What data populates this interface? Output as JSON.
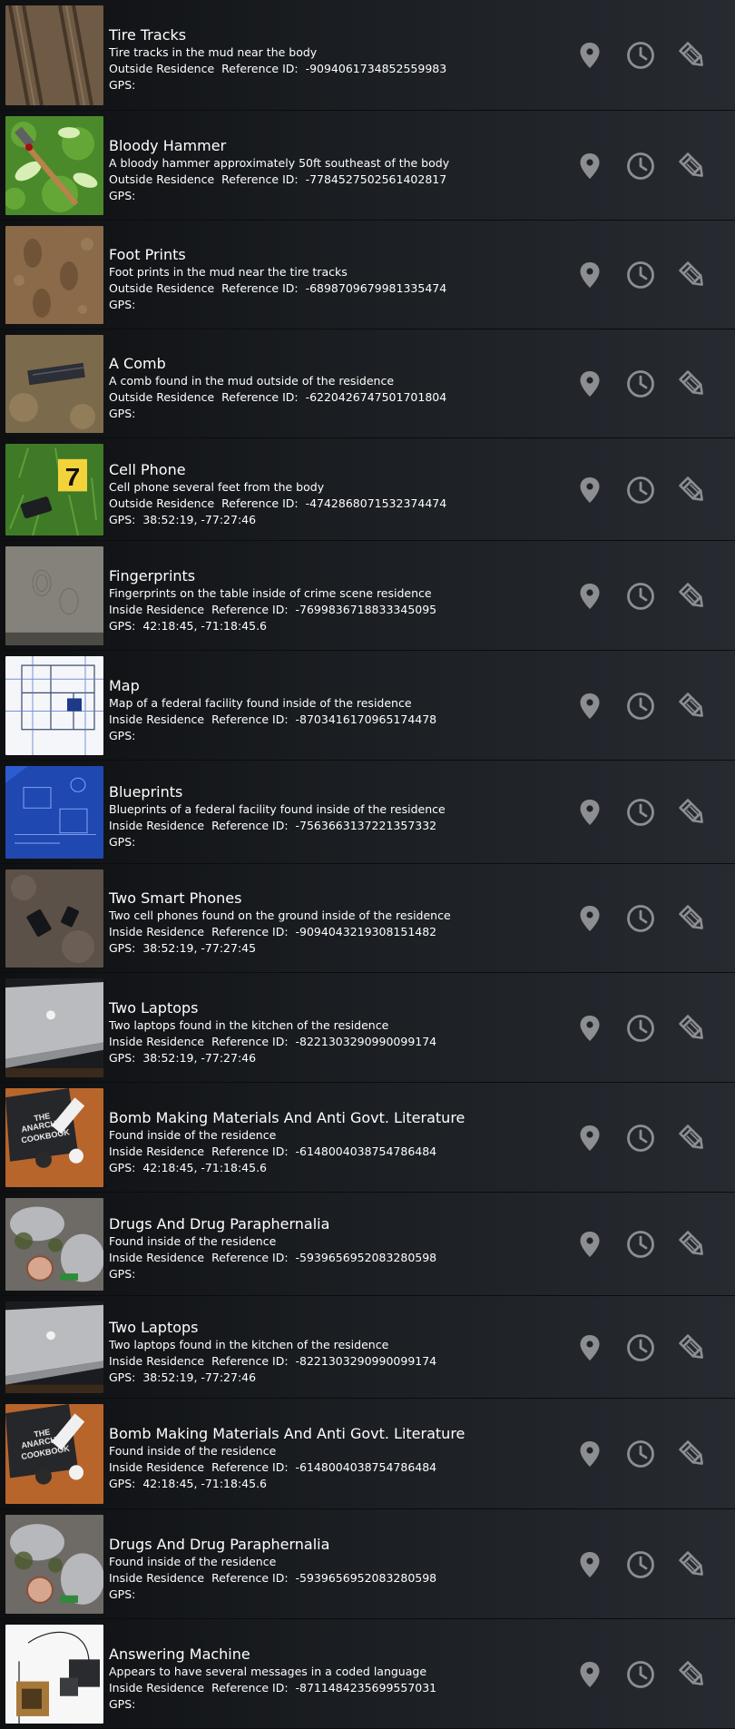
{
  "labels": {
    "reference_prefix": "Reference ID:",
    "gps_prefix": "GPS:"
  },
  "icons": {
    "location": "map-pin-icon",
    "history": "clock-icon",
    "edit": "pencil-icon"
  },
  "colors": {
    "icon": "#8c8e92",
    "text": "#ffffff"
  },
  "items": [
    {
      "title": "Tire Tracks",
      "description": "Tire tracks in the mud near the body",
      "location": "Outside Residence",
      "reference_id": "-9094061734852559983",
      "gps": "",
      "thumb": "tire-tracks"
    },
    {
      "title": "Bloody Hammer",
      "description": "A bloody hammer approximately 50ft southeast of the body",
      "location": "Outside Residence",
      "reference_id": "-7784527502561402817",
      "gps": "",
      "thumb": "hammer"
    },
    {
      "title": "Foot Prints",
      "description": "Foot prints in the mud near the tire tracks",
      "location": "Outside Residence",
      "reference_id": "-6898709679981335474",
      "gps": "",
      "thumb": "mud"
    },
    {
      "title": "A Comb",
      "description": "A comb found in the mud outside of the residence",
      "location": "Outside Residence",
      "reference_id": "-6220426747501701804",
      "gps": "",
      "thumb": "comb"
    },
    {
      "title": "Cell Phone",
      "description": "Cell phone several feet from the body",
      "location": "Outside Residence",
      "reference_id": "-4742868071532374474",
      "gps": "38:52:19, -77:27:46",
      "thumb": "cellphone"
    },
    {
      "title": "Fingerprints",
      "description": "Fingerprints on the table inside of crime scene residence",
      "location": "Inside Residence",
      "reference_id": "-7699836718833345095",
      "gps": "42:18:45, -71:18:45.6",
      "thumb": "fingerprints"
    },
    {
      "title": "Map",
      "description": "Map of a federal facility found inside of the residence",
      "location": "Inside Residence",
      "reference_id": "-8703416170965174478",
      "gps": "",
      "thumb": "map"
    },
    {
      "title": "Blueprints",
      "description": "Blueprints of a federal facility found inside of the residence",
      "location": "Inside Residence",
      "reference_id": "-7563663137221357332",
      "gps": "",
      "thumb": "blueprint"
    },
    {
      "title": "Two Smart Phones",
      "description": "Two cell phones found on the ground inside of the residence",
      "location": "Inside Residence",
      "reference_id": "-9094043219308151482",
      "gps": "38:52:19, -77:27:45",
      "thumb": "phones"
    },
    {
      "title": "Two Laptops",
      "description": "Two laptops found in the kitchen of the residence",
      "location": "Inside Residence",
      "reference_id": "-8221303290990099174",
      "gps": "38:52:19, -77:27:46",
      "thumb": "laptop"
    },
    {
      "title": "Bomb Making Materials And Anti Govt. Literature",
      "description": "Found inside of the residence",
      "location": "Inside Residence",
      "reference_id": "-6148004038754786484",
      "gps": "42:18:45, -71:18:45.6",
      "thumb": "book"
    },
    {
      "title": "Drugs And Drug Paraphernalia",
      "description": "Found inside of the residence",
      "location": "Inside Residence",
      "reference_id": "-5939656952083280598",
      "gps": "",
      "thumb": "drugs"
    },
    {
      "title": "Two Laptops",
      "description": "Two laptops found in the kitchen of the residence",
      "location": "Inside Residence",
      "reference_id": "-8221303290990099174",
      "gps": "38:52:19, -77:27:46",
      "thumb": "laptop"
    },
    {
      "title": "Bomb Making Materials And Anti Govt. Literature",
      "description": "Found inside of the residence",
      "location": "Inside Residence",
      "reference_id": "-6148004038754786484",
      "gps": "42:18:45, -71:18:45.6",
      "thumb": "book"
    },
    {
      "title": "Drugs And Drug Paraphernalia",
      "description": "Found inside of the residence",
      "location": "Inside Residence",
      "reference_id": "-5939656952083280598",
      "gps": "",
      "thumb": "drugs"
    },
    {
      "title": "Answering Machine",
      "description": "Appears to have several messages in a coded language",
      "location": "Inside Residence",
      "reference_id": "-8711484235699557031",
      "gps": "",
      "thumb": "machine"
    }
  ]
}
